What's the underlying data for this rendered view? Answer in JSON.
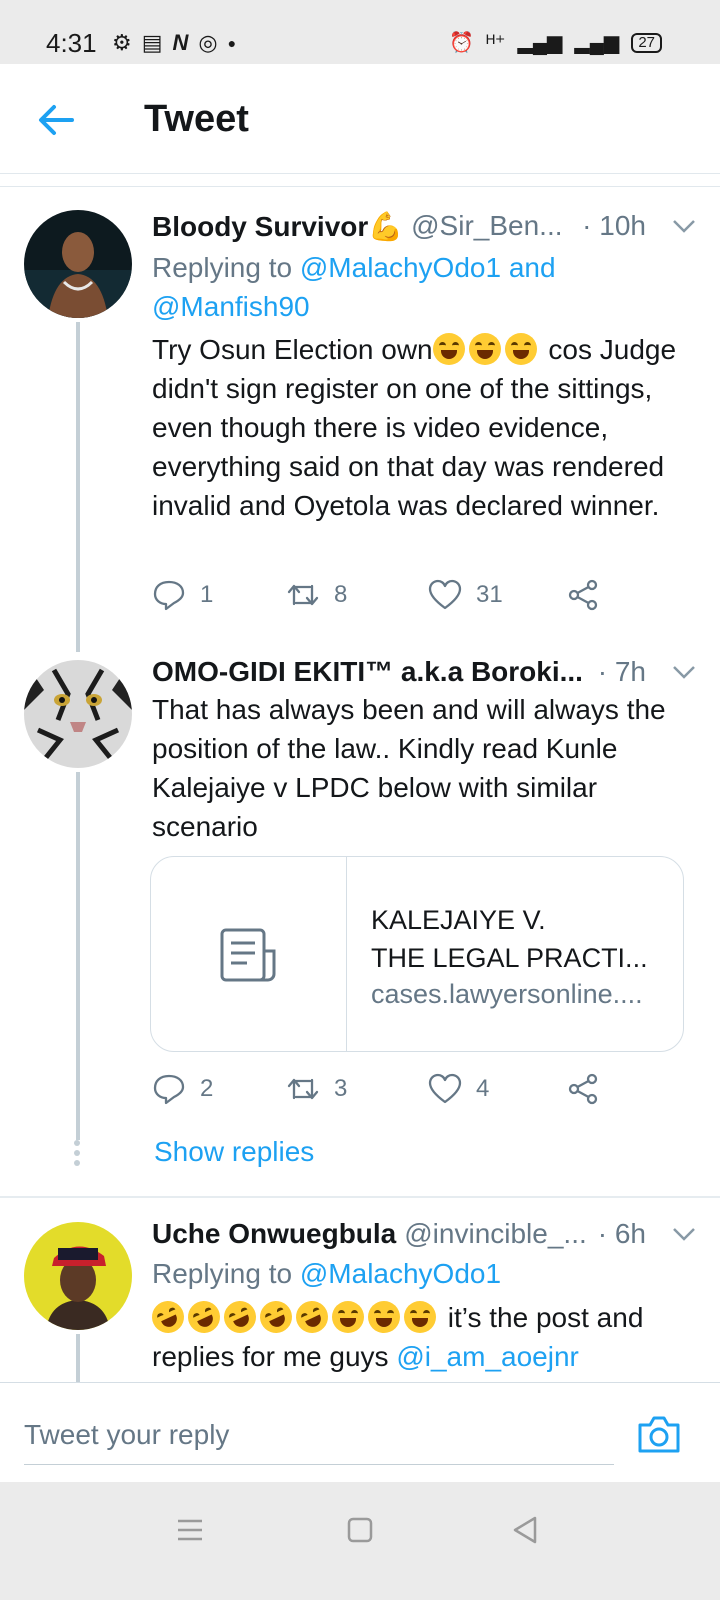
{
  "status_bar": {
    "time": "4:31",
    "left_icons": [
      "gear-icon",
      "news-icon",
      "n-app-icon",
      "instagram-icon",
      "dot-icon"
    ],
    "right_text": "ᴴ⁺",
    "battery": "27"
  },
  "header": {
    "title": "Tweet"
  },
  "tweets": [
    {
      "name": "Bloody Survivor💪",
      "handle": "@Sir_Ben...",
      "time": "· 10h",
      "reply_prefix": "Replying to ",
      "reply_mentions": "@MalachyOdo1 and @Manfish90",
      "body_before": "Try Osun Election own",
      "body_after": " cos Judge didn't sign register on one of the sittings, even though there is video evidence, everything said on that day was rendered invalid and Oyetola was declared winner.",
      "replies": "1",
      "retweets": "8",
      "likes": "31"
    },
    {
      "name": "OMO-GIDI EKITI™ a.k.a Boroki...",
      "time": "· 7h",
      "body": "That has always been  and will always the position of the law.. Kindly read Kunle Kalejaiye v LPDC below with similar scenario",
      "card": {
        "title_line1": "KALEJAIYE V.",
        "title_line2": "THE LEGAL PRACTI...",
        "domain": "cases.lawyersonline...."
      },
      "replies": "2",
      "retweets": "3",
      "likes": "4",
      "show_replies": "Show replies"
    },
    {
      "name": "Uche Onwuegbula",
      "handle": "@invincible_...",
      "time": "· 6h",
      "reply_prefix": "Replying to ",
      "reply_mentions": "@MalachyOdo1",
      "body_after": " it’s the post and replies for me guys ",
      "body_mention": "@i_am_aoejnr"
    }
  ],
  "composer": {
    "placeholder": "Tweet your reply"
  }
}
